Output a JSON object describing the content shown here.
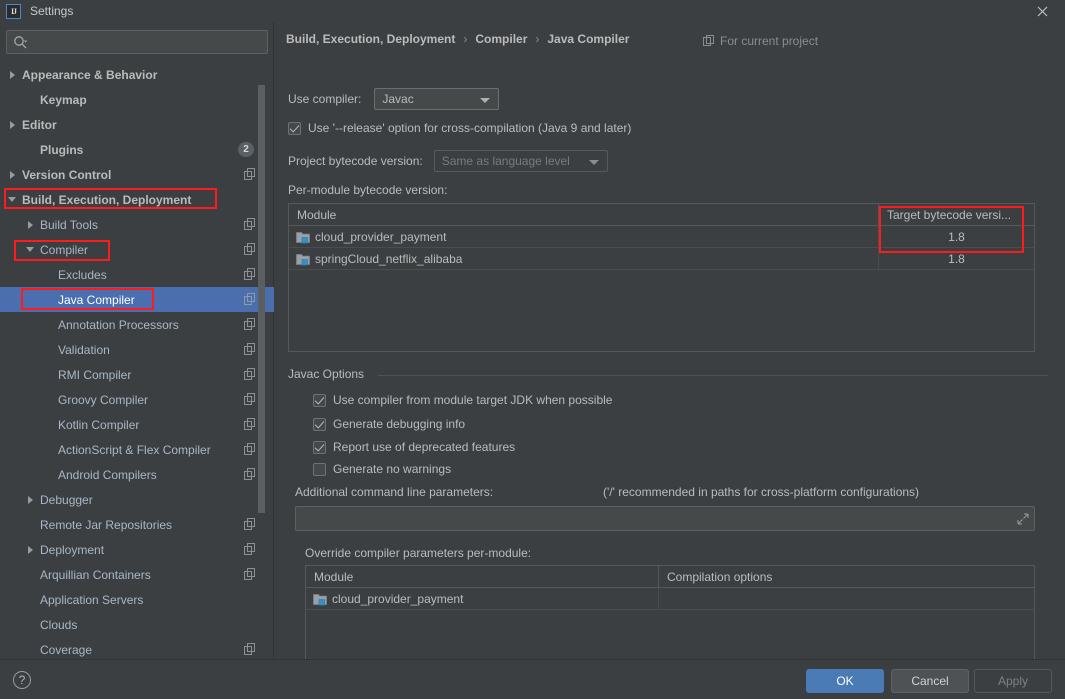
{
  "window": {
    "title": "Settings",
    "logo_text": "IJ",
    "close_icon": "close-icon"
  },
  "sidebar": {
    "search": {
      "value": "",
      "placeholder": "",
      "icon": "search-icon"
    },
    "items": [
      {
        "label": "Appearance & Behavior",
        "arrow": "right",
        "indent": 0,
        "bold": true,
        "badge": null,
        "copy": false,
        "selected": false
      },
      {
        "label": "Keymap",
        "arrow": "none",
        "indent": 1,
        "bold": true,
        "badge": null,
        "copy": false,
        "selected": false
      },
      {
        "label": "Editor",
        "arrow": "right",
        "indent": 0,
        "bold": true,
        "badge": null,
        "copy": false,
        "selected": false
      },
      {
        "label": "Plugins",
        "arrow": "none",
        "indent": 1,
        "bold": true,
        "badge": "2",
        "copy": false,
        "selected": false
      },
      {
        "label": "Version Control",
        "arrow": "right",
        "indent": 0,
        "bold": true,
        "badge": null,
        "copy": true,
        "selected": false
      },
      {
        "label": "Build, Execution, Deployment",
        "arrow": "down",
        "indent": 0,
        "bold": true,
        "badge": null,
        "copy": false,
        "selected": false
      },
      {
        "label": "Build Tools",
        "arrow": "right",
        "indent": 1,
        "bold": false,
        "badge": null,
        "copy": true,
        "selected": false
      },
      {
        "label": "Compiler",
        "arrow": "down",
        "indent": 1,
        "bold": false,
        "badge": null,
        "copy": true,
        "selected": false
      },
      {
        "label": "Excludes",
        "arrow": "none",
        "indent": 2,
        "bold": false,
        "badge": null,
        "copy": true,
        "selected": false
      },
      {
        "label": "Java Compiler",
        "arrow": "none",
        "indent": 2,
        "bold": false,
        "badge": null,
        "copy": true,
        "selected": true
      },
      {
        "label": "Annotation Processors",
        "arrow": "none",
        "indent": 2,
        "bold": false,
        "badge": null,
        "copy": true,
        "selected": false
      },
      {
        "label": "Validation",
        "arrow": "none",
        "indent": 2,
        "bold": false,
        "badge": null,
        "copy": true,
        "selected": false
      },
      {
        "label": "RMI Compiler",
        "arrow": "none",
        "indent": 2,
        "bold": false,
        "badge": null,
        "copy": true,
        "selected": false
      },
      {
        "label": "Groovy Compiler",
        "arrow": "none",
        "indent": 2,
        "bold": false,
        "badge": null,
        "copy": true,
        "selected": false
      },
      {
        "label": "Kotlin Compiler",
        "arrow": "none",
        "indent": 2,
        "bold": false,
        "badge": null,
        "copy": true,
        "selected": false
      },
      {
        "label": "ActionScript & Flex Compiler",
        "arrow": "none",
        "indent": 2,
        "bold": false,
        "badge": null,
        "copy": true,
        "selected": false
      },
      {
        "label": "Android Compilers",
        "arrow": "none",
        "indent": 2,
        "bold": false,
        "badge": null,
        "copy": true,
        "selected": false
      },
      {
        "label": "Debugger",
        "arrow": "right",
        "indent": 1,
        "bold": false,
        "badge": null,
        "copy": false,
        "selected": false
      },
      {
        "label": "Remote Jar Repositories",
        "arrow": "none",
        "indent": 1,
        "bold": false,
        "badge": null,
        "copy": true,
        "selected": false
      },
      {
        "label": "Deployment",
        "arrow": "right",
        "indent": 1,
        "bold": false,
        "badge": null,
        "copy": true,
        "selected": false
      },
      {
        "label": "Arquillian Containers",
        "arrow": "none",
        "indent": 1,
        "bold": false,
        "badge": null,
        "copy": true,
        "selected": false
      },
      {
        "label": "Application Servers",
        "arrow": "none",
        "indent": 1,
        "bold": false,
        "badge": null,
        "copy": false,
        "selected": false
      },
      {
        "label": "Clouds",
        "arrow": "none",
        "indent": 1,
        "bold": false,
        "badge": null,
        "copy": false,
        "selected": false
      },
      {
        "label": "Coverage",
        "arrow": "none",
        "indent": 1,
        "bold": false,
        "badge": null,
        "copy": true,
        "selected": false
      }
    ]
  },
  "content": {
    "breadcrumb": [
      "Build, Execution, Deployment",
      "Compiler",
      "Java Compiler"
    ],
    "breadcrumb_separator": "›",
    "for_current_project": "For current project",
    "use_compiler_label": "Use compiler:",
    "use_compiler_value": "Javac",
    "release_checkbox": {
      "label": "Use '--release' option for cross-compilation (Java 9 and later)",
      "checked": true
    },
    "project_bytecode_label": "Project bytecode version:",
    "project_bytecode_value": "Same as language level",
    "per_module_label": "Per-module bytecode version:",
    "module_table": {
      "columns": [
        "Module",
        "Target bytecode versi..."
      ],
      "rows": [
        {
          "module": "cloud_provider_payment",
          "target": "1.8"
        },
        {
          "module": "springCloud_netflix_alibaba",
          "target": "1.8"
        }
      ],
      "add_label": "+",
      "remove_label": "–"
    },
    "javac_group_title": "Javac Options",
    "javac_checkboxes": [
      {
        "label": "Use compiler from module target JDK when possible",
        "checked": true
      },
      {
        "label": "Generate debugging info",
        "checked": true
      },
      {
        "label": "Report use of deprecated features",
        "checked": true
      },
      {
        "label": "Generate no warnings",
        "checked": false
      }
    ],
    "additional_params_label": "Additional command line parameters:",
    "additional_params_hint": "('/' recommended in paths for cross-platform configurations)",
    "additional_params_value": "",
    "override_label": "Override compiler parameters per-module:",
    "override_table": {
      "columns": [
        "Module",
        "Compilation options"
      ],
      "rows": [
        {
          "module": "cloud_provider_payment",
          "options": ""
        }
      ],
      "add_label": "+",
      "remove_label": "–"
    }
  },
  "footer": {
    "help_label": "?",
    "ok_label": "OK",
    "cancel_label": "Cancel",
    "apply_label": "Apply"
  },
  "colors": {
    "background": "#3c3f41",
    "selection": "#4b6eaf",
    "accent_button": "#4a7bb4",
    "annotation_red": "#ff1b1b",
    "text": "#bbbbbb"
  }
}
